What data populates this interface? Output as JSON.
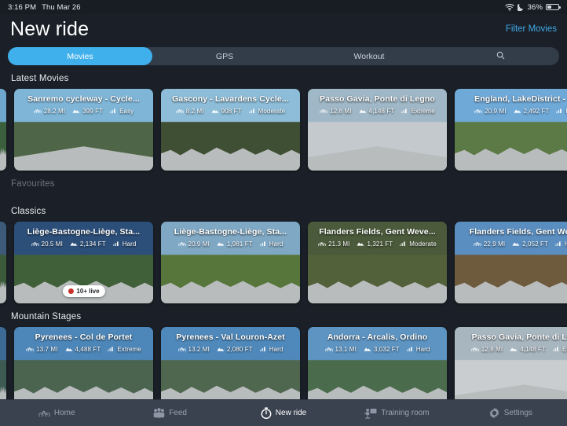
{
  "statusbar": {
    "time": "3:16 PM",
    "date": "Thu Mar 26",
    "wifi_icon": "wifi-icon",
    "dnd_icon": "moon-icon",
    "battery_percent": "36%",
    "battery_icon": "battery-icon"
  },
  "header": {
    "title": "New ride",
    "filter_label": "Filter Movies"
  },
  "segments": [
    {
      "label": "Movies",
      "active": true
    },
    {
      "label": "GPS",
      "active": false
    },
    {
      "label": "Workout",
      "active": false
    }
  ],
  "search": {
    "icon": "search-icon"
  },
  "sections": [
    {
      "title": "Latest Movies",
      "dim": false,
      "cards": [
        {
          "sliver": true,
          "sky": "#6fa8cf",
          "land": "#3c5f3d",
          "road": "rough"
        },
        {
          "title": "Sanremo cycleway - Cycle...",
          "distance": "28.2 MI",
          "elevation": "399 FT",
          "difficulty": "Easy",
          "sky": "#7fb6d8",
          "land": "#4e6647",
          "road": "smooth",
          "live": null
        },
        {
          "title": "Gascony - Lavardens Cycle...",
          "distance": "8.2 MI",
          "elevation": "908 FT",
          "difficulty": "Moderate",
          "sky": "#8dbdd8",
          "land": "#3f4f33",
          "road": "rough",
          "live": null
        },
        {
          "title": "Passo Gavia, Ponte di Legno",
          "distance": "12.8 MI",
          "elevation": "4,148 FT",
          "difficulty": "Extreme",
          "sky": "#9fb7c6",
          "land": "#c3c9cc",
          "road": "smooth",
          "live": null
        },
        {
          "title": "England, LakeDistrict - B",
          "distance": "20.9 MI",
          "elevation": "2,492 FT",
          "difficulty": "Ha",
          "sky": "#6fa9d8",
          "land": "#5b7a46",
          "road": "rough",
          "live": null
        }
      ]
    },
    {
      "title": "Favourites",
      "dim": true,
      "cards": []
    },
    {
      "title": "Classics",
      "dim": false,
      "cards": [
        {
          "sliver": true,
          "sky": "#3d5a78",
          "land": "#3b5a3a",
          "road": "rough"
        },
        {
          "title": "Liège-Bastogne-Liège, Sta...",
          "distance": "20.5 MI",
          "elevation": "2,134 FT",
          "difficulty": "Hard",
          "sky": "#2c4f7a",
          "land": "#3f6038",
          "road": "rough",
          "live": "10+ live"
        },
        {
          "title": "Liège-Bastogne-Liège, Sta...",
          "distance": "20.9 MI",
          "elevation": "1,981 FT",
          "difficulty": "Hard",
          "sky": "#7fa8c4",
          "land": "#57763c",
          "road": "rough",
          "live": null
        },
        {
          "title": "Flanders Fields, Gent Weve...",
          "distance": "21.3 MI",
          "elevation": "1,321 FT",
          "difficulty": "Moderate",
          "sky": "#4a5a3a",
          "land": "#53613a",
          "road": "rough",
          "live": null
        },
        {
          "title": "Flanders Fields, Gent Weve",
          "distance": "22.9 MI",
          "elevation": "2,052 FT",
          "difficulty": "Har",
          "sky": "#5a8ec0",
          "land": "#6e5a3c",
          "road": "rough",
          "live": null
        }
      ]
    },
    {
      "title": "Mountain Stages",
      "dim": false,
      "cards": [
        {
          "sliver": true,
          "sky": "#3c6a94",
          "land": "#3c5a52",
          "road": "rough"
        },
        {
          "title": "Pyrenees - Col de Portet",
          "distance": "13.7 MI",
          "elevation": "4,488 FT",
          "difficulty": "Extreme",
          "sky": "#4d86b8",
          "land": "#4a6450",
          "road": "rough",
          "live": null
        },
        {
          "title": "Pyrenees - Val Louron-Azet",
          "distance": "13.2 MI",
          "elevation": "2,080 FT",
          "difficulty": "Hard",
          "sky": "#4f89bb",
          "land": "#50674f",
          "road": "rough",
          "live": null
        },
        {
          "title": "Andorra - Arcalis, Ordino",
          "distance": "13.1 MI",
          "elevation": "3,032 FT",
          "difficulty": "Hard",
          "sky": "#5d94c2",
          "land": "#4a6c4c",
          "road": "rough",
          "live": null
        },
        {
          "title": "Passo Gavia, Ponte di Leg",
          "distance": "12.8 MI",
          "elevation": "4,148 FT",
          "difficulty": "Extre",
          "sky": "#a8b6c0",
          "land": "#c9cdd0",
          "road": "smooth",
          "live": null
        }
      ]
    }
  ],
  "tabbar": [
    {
      "label": "Home",
      "icon": "bicycle-icon",
      "active": false
    },
    {
      "label": "Feed",
      "icon": "people-icon",
      "active": false
    },
    {
      "label": "New ride",
      "icon": "stopwatch-icon",
      "active": true
    },
    {
      "label": "Training room",
      "icon": "training-icon",
      "active": false
    },
    {
      "label": "Settings",
      "icon": "gear-icon",
      "active": false
    }
  ],
  "colors": {
    "accent": "#3fb0ec",
    "link": "#3fa9e8",
    "background": "#1b2028",
    "tabbar": "#3a424f",
    "live_dot": "#c6322b"
  }
}
